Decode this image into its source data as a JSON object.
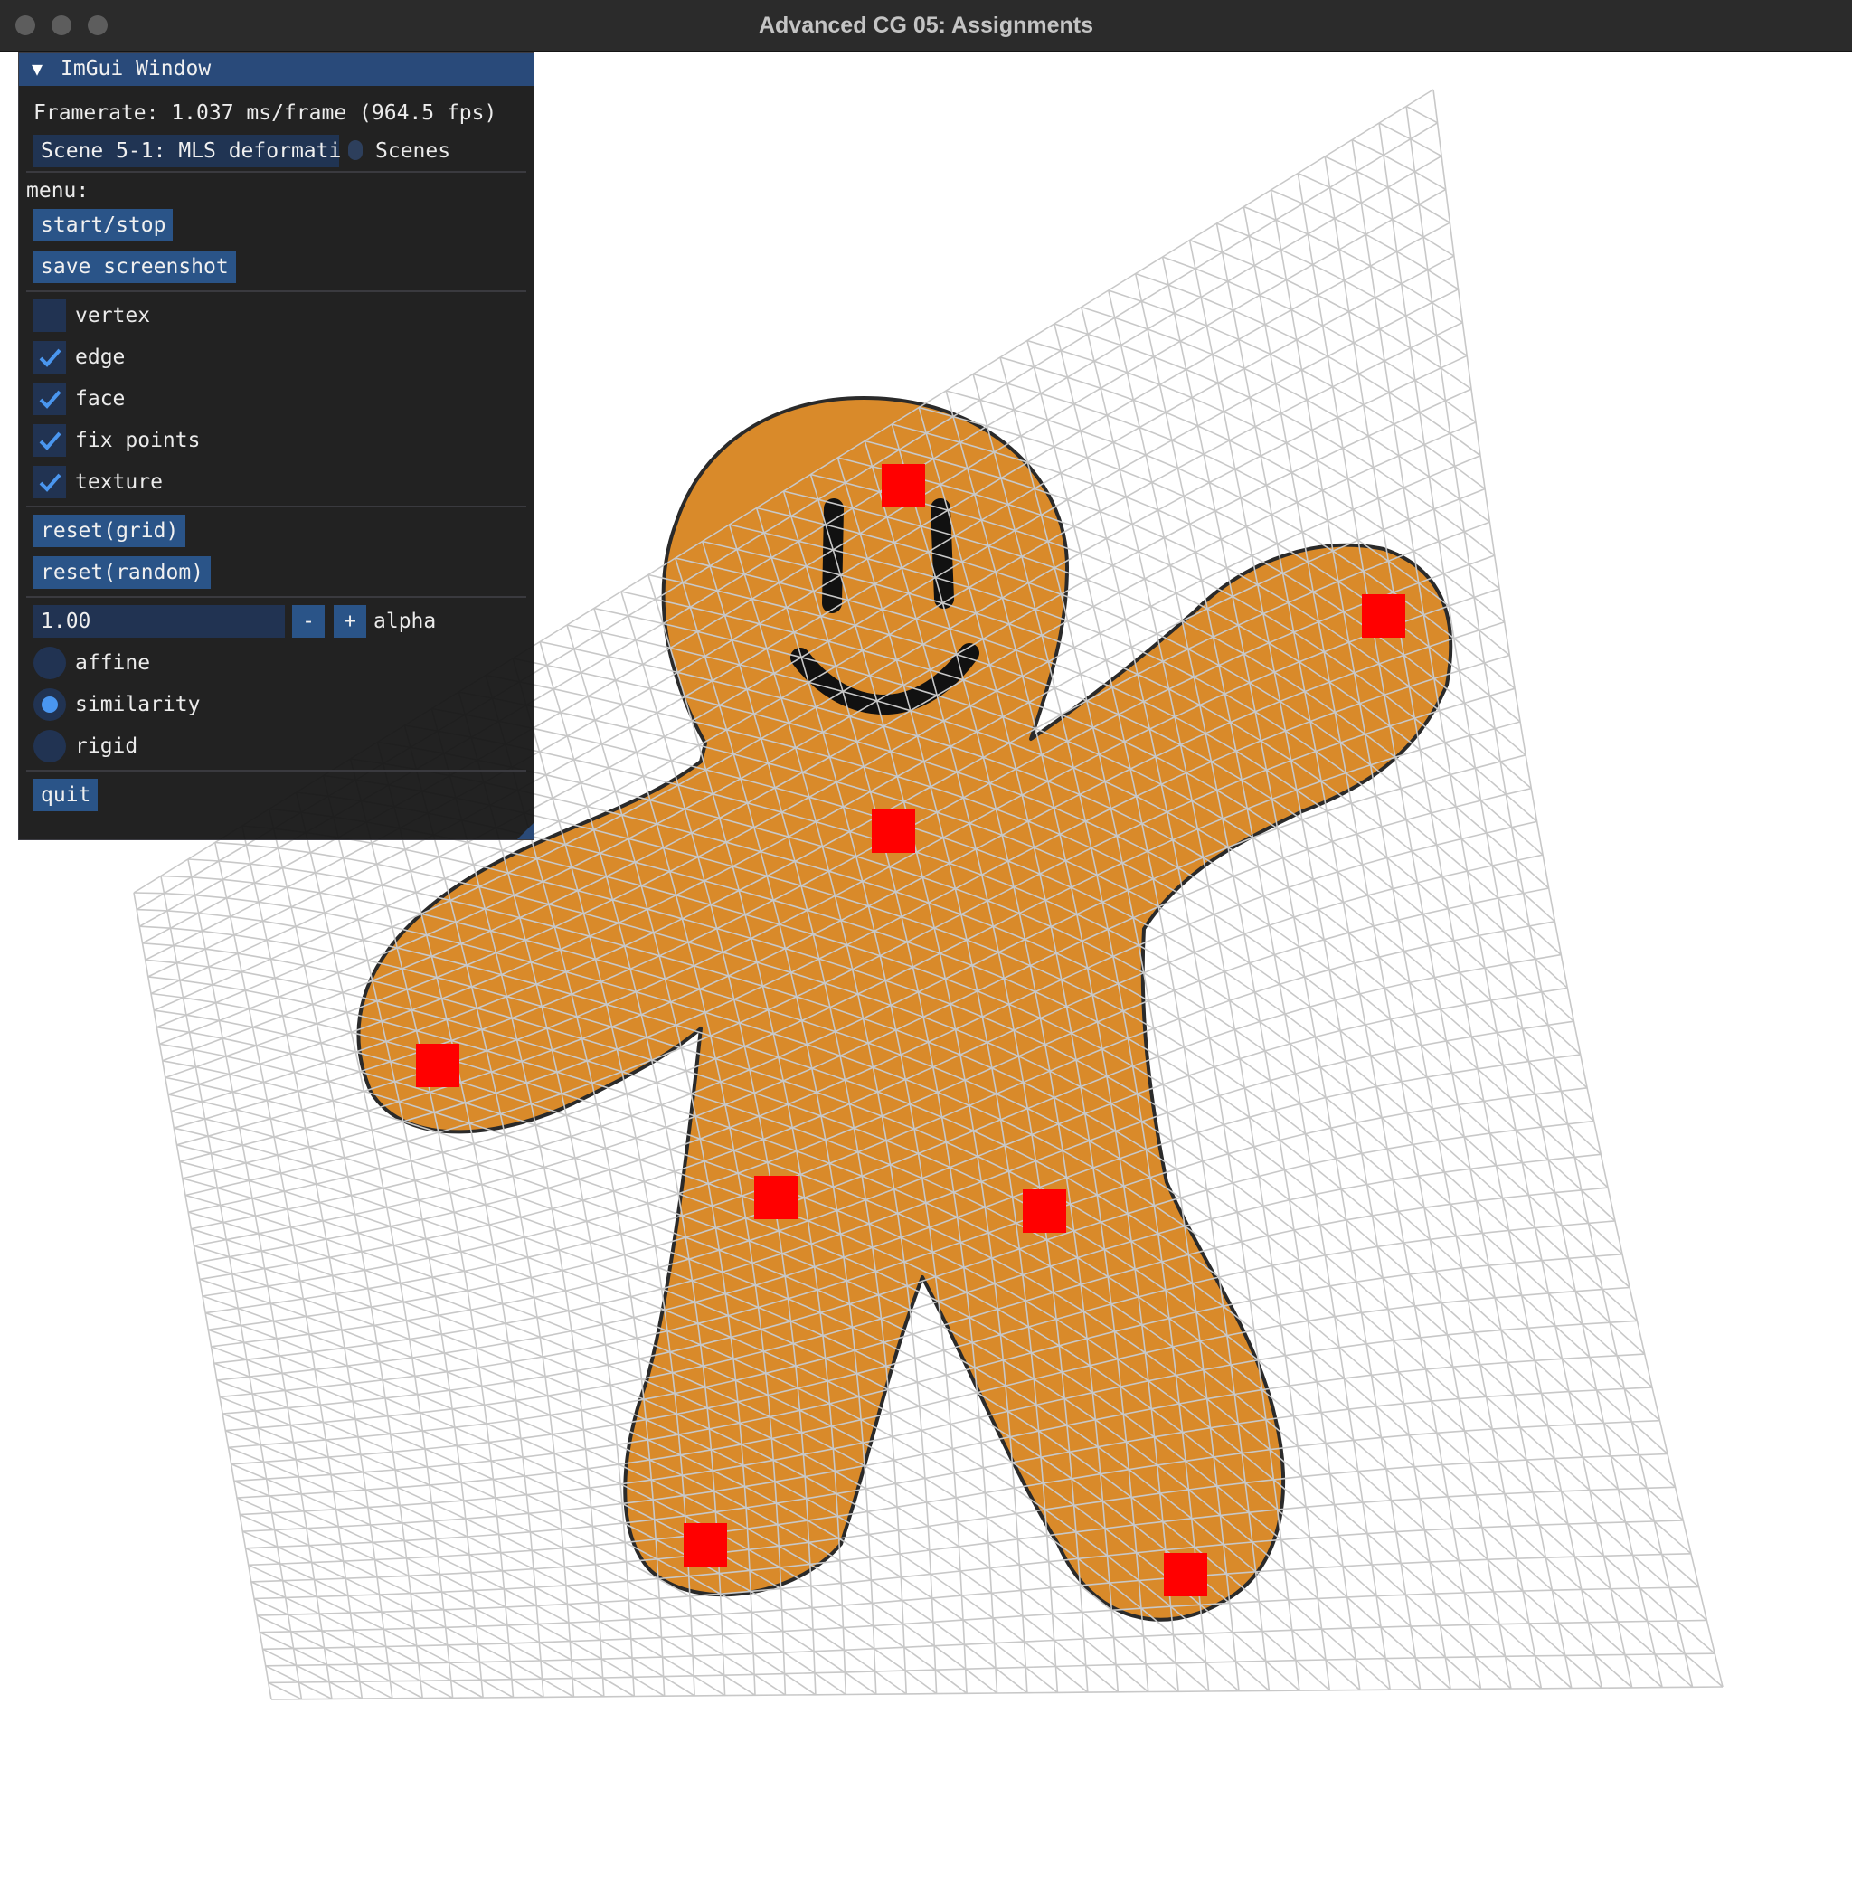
{
  "window": {
    "title": "Advanced CG 05: Assignments"
  },
  "imgui": {
    "title": "ImGui Window",
    "framerate": "Framerate: 1.037 ms/frame (964.5 fps)",
    "scene_combo_value": "Scene 5-1: MLS deformati",
    "scene_combo_label": "Scenes",
    "menu_label": "menu:",
    "start_stop": "start/stop",
    "save_screenshot": "save screenshot",
    "checkboxes": [
      {
        "label": "vertex",
        "checked": false
      },
      {
        "label": "edge",
        "checked": true
      },
      {
        "label": "face",
        "checked": true
      },
      {
        "label": "fix points",
        "checked": true
      },
      {
        "label": "texture",
        "checked": true
      }
    ],
    "reset_grid": "reset(grid)",
    "reset_random": "reset(random)",
    "alpha_value": "1.00",
    "minus": "-",
    "plus": "+",
    "alpha_label": "alpha",
    "radios": [
      {
        "label": "affine",
        "selected": false
      },
      {
        "label": "similarity",
        "selected": true
      },
      {
        "label": "rigid",
        "selected": false
      }
    ],
    "quit": "quit"
  },
  "colors": {
    "titlebar": "#2b2b2b",
    "imgui_header": "#294a7a",
    "button": "#2a5488",
    "checkmark": "#4a96ef",
    "cookie": "#d98a2a",
    "fix_point": "#ff0000",
    "grid_line": "#c8c8c8"
  }
}
